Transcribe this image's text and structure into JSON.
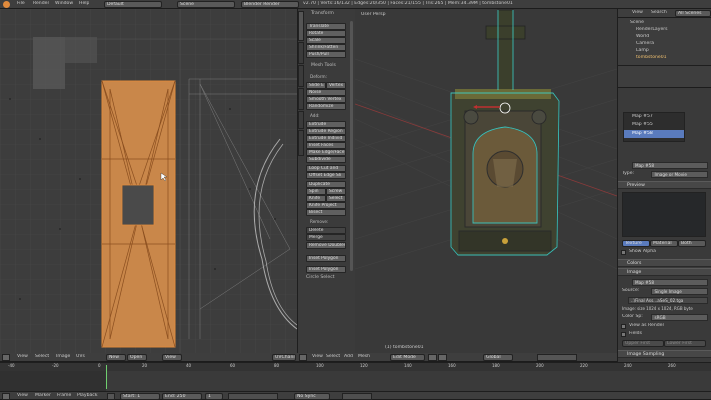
{
  "colors": {
    "accent": "#e08a3c",
    "selection": "#5a7bbd",
    "timeline_marker": "#6fcf6f"
  },
  "topbar": {
    "menus": [
      "File",
      "Render",
      "Window",
      "Help"
    ],
    "layout": "Default",
    "scene": "Scene",
    "engine": "Blender Render",
    "stats": "v2.70 | Verts:16/132 | Edges:20/350 | Faces:21/155 | Tris:265 | Mem:34.39M | tombstone01"
  },
  "uv_editor": {
    "menus": [
      "View",
      "Select",
      "Image",
      "UVs"
    ],
    "new_label": "New",
    "open_label": "Open",
    "view_label": "View",
    "uv_channel": "UVChann"
  },
  "toolshelf": {
    "transform": {
      "title": "Transform",
      "buttons": [
        "Translate",
        "Rotate",
        "Scale",
        "Shrink/Fatten",
        "Push/Pull"
      ]
    },
    "mesh_tools": {
      "title": "Mesh Tools",
      "deform_label": "Deform:",
      "deform_pair": [
        "Slide E",
        "Vertex"
      ],
      "deform_buttons": [
        "Noise",
        "Smooth Vertex",
        "Randomize"
      ]
    },
    "add": {
      "label": "Add:",
      "buttons": [
        "Extrude",
        "Extrude Region",
        "Extrude Individ",
        "Inset Faces",
        "Make Edge/Face",
        "Subdivide",
        "Loop Cut and",
        "Offset Edge Sli",
        "Duplicate"
      ],
      "spin_pair": [
        "Spin",
        "Screw"
      ],
      "knife_pair": [
        "Knife",
        "Select"
      ],
      "after": [
        "Knife Project",
        "Bisect"
      ]
    },
    "remove": {
      "label": "Remove:",
      "buttons": [
        "Delete",
        "Merge",
        "Remove Doubles"
      ]
    },
    "extra": [
      "Inset Polygon",
      "Inset Polygon"
    ],
    "circle_select": "Circle Select",
    "tabs": [
      "Tools",
      "Create",
      "Relations",
      "Animation",
      "Physics",
      "Grease Pencil"
    ]
  },
  "viewport": {
    "label": "User Persp",
    "object_name": "(1) tombstone01",
    "header": {
      "menus": [
        "View",
        "Select",
        "Add",
        "Mesh"
      ],
      "mode": "Edit Mode",
      "orientation": "Global"
    }
  },
  "outliner": {
    "menus": [
      "View",
      "Search"
    ],
    "filter": "All Scenes",
    "items": [
      "Scene",
      "RenderLayers",
      "World",
      "Camera",
      "Lamp",
      "tombstone01"
    ]
  },
  "properties": {
    "textures": [
      "Map #57",
      "Map #55",
      "Map #58"
    ],
    "texture_name": "Map #58",
    "type_label": "Type:",
    "type_value": "Image or Movie",
    "preview_title": "Preview",
    "preview_tabs": [
      "Texture",
      "Material",
      "Both"
    ],
    "show_alpha": "Show Alpha",
    "colors_title": "Colors",
    "image_title": "Image",
    "image_name": "Map #58",
    "source_label": "Source:",
    "source_value": "Single Image",
    "filepath": "..\\Final Ass...aSeS_02.tga",
    "image_info": "Image: size 1024 x 1024, RGB byte",
    "colorsp_label": "Color Sp:",
    "colorsp_value": "sRGB",
    "view_as_render": "View as Render",
    "fields": "Fields",
    "field_options": [
      "Upper First",
      "Lower First"
    ],
    "sampling_title": "Image Sampling",
    "alpha_label": "Alpha:",
    "normal_map": "Normal Map",
    "use": "Use",
    "tangent": "Tangent",
    "calculate": "Calculate",
    "derivative": "Derivative",
    "invert": "Invert",
    "mip_map": "MIP Map"
  },
  "timeline": {
    "ticks": [
      "-40",
      "-20",
      "0",
      "20",
      "40",
      "60",
      "80",
      "100",
      "120",
      "140",
      "160",
      "180",
      "200",
      "220",
      "240",
      "260"
    ],
    "menus": [
      "View",
      "Marker",
      "Frame",
      "Playback"
    ],
    "start": "Start:",
    "start_val": "1",
    "end": "End:",
    "end_val": "250",
    "current": "1",
    "sync": "No Sync"
  }
}
